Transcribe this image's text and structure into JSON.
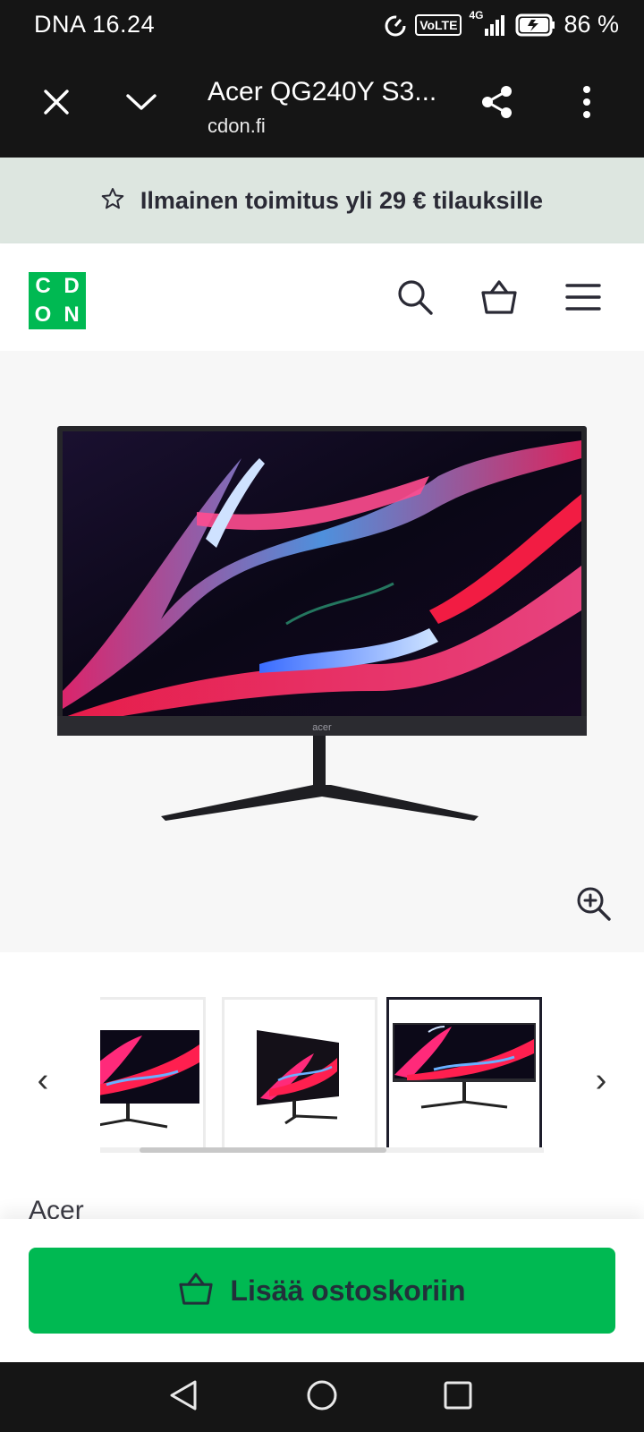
{
  "status_bar": {
    "time": "DNA 16.24",
    "battery": "86 %",
    "network": "4G",
    "volte": "VoLTE"
  },
  "browser": {
    "page_title": "Acer QG240Y S3...",
    "domain": "cdon.fi",
    "icons": [
      "close-icon",
      "chevron-down-icon",
      "share-icon",
      "more-vert-icon"
    ]
  },
  "promo": {
    "text": "Ilmainen toimitus yli 29 € tilauksille",
    "icon": "star-outline-icon"
  },
  "site_header": {
    "logo_letters": [
      "C",
      "D",
      "O",
      "N"
    ],
    "logo_color": "#00b952",
    "icons": [
      "search-icon",
      "basket-icon",
      "menu-icon"
    ]
  },
  "product": {
    "brand": "Acer",
    "monitor_logo": "acer",
    "zoom_icon": "zoom-in-icon"
  },
  "thumbnails": {
    "prev_label": "‹",
    "next_label": "›",
    "items": [
      "front view",
      "angled view",
      "front view"
    ],
    "selected_index": 2
  },
  "cta": {
    "label": "Lisää ostoskoriin",
    "icon": "basket-icon",
    "color": "#00b952"
  },
  "android_nav": {
    "icons": [
      "back-icon",
      "home-icon",
      "recents-icon"
    ]
  }
}
